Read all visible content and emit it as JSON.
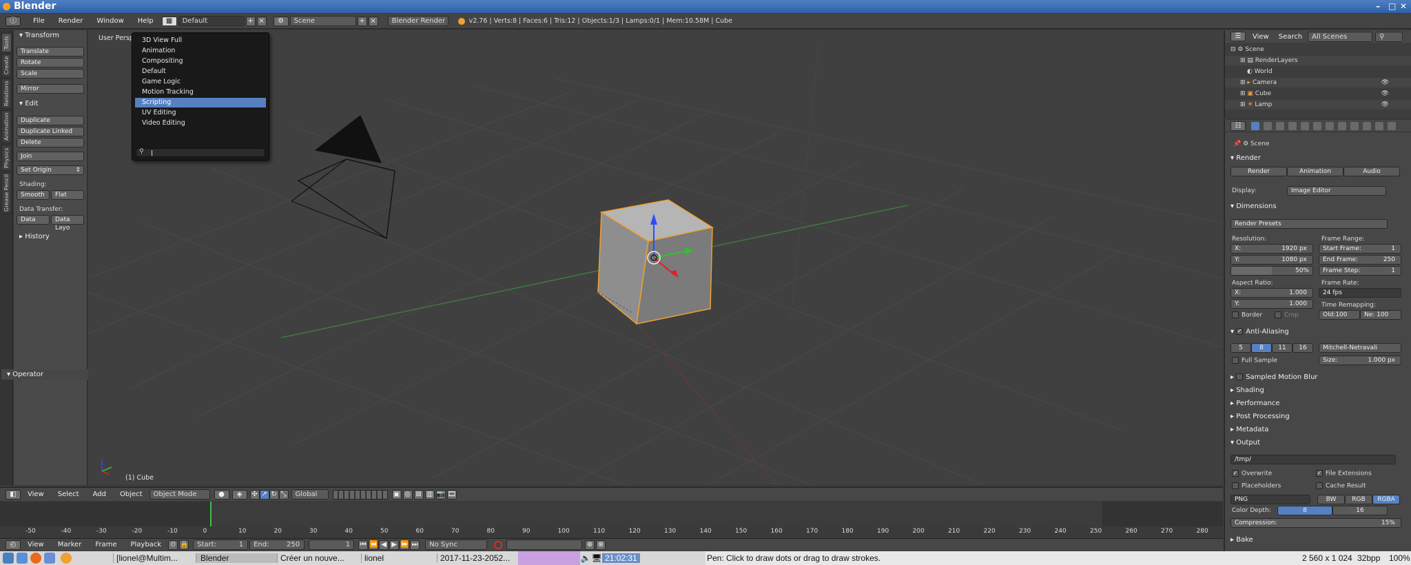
{
  "window": {
    "title": "Blender"
  },
  "menubar": {
    "items": [
      "File",
      "Render",
      "Window",
      "Help"
    ],
    "layout": "Default",
    "scene": "Scene",
    "engine": "Blender Render",
    "stats": "v2.76 | Verts:8 | Faces:6 | Tris:12 | Objects:1/3 | Lamps:0/1 | Mem:10.58M | Cube"
  },
  "tabs": [
    "Tools",
    "Create",
    "Relations",
    "Animation",
    "Physics",
    "Grease Pencil"
  ],
  "tools": {
    "transform_header": "Transform",
    "translate": "Translate",
    "rotate": "Rotate",
    "scale": "Scale",
    "mirror": "Mirror",
    "edit_header": "Edit",
    "duplicate": "Duplicate",
    "duplicate_linked": "Duplicate Linked",
    "delete": "Delete",
    "join": "Join",
    "set_origin": "Set Origin",
    "shading_label": "Shading:",
    "smooth": "Smooth",
    "flat": "Flat",
    "data_transfer_label": "Data Transfer:",
    "data": "Data",
    "data_layo": "Data Layo",
    "history_header": "History",
    "operator_header": "Operator"
  },
  "viewport": {
    "persp": "User Persp",
    "object_label": "(1) Cube"
  },
  "dropdown": {
    "items": [
      "3D View Full",
      "Animation",
      "Compositing",
      "Default",
      "Game Logic",
      "Motion Tracking",
      "Scripting",
      "UV Editing",
      "Video Editing"
    ],
    "selected": "Scripting"
  },
  "vp_header": {
    "view": "View",
    "select": "Select",
    "add": "Add",
    "object": "Object",
    "mode": "Object Mode",
    "orientation": "Global"
  },
  "timeline": {
    "ticks": [
      "-50",
      "-40",
      "-30",
      "-20",
      "-10",
      "0",
      "10",
      "20",
      "30",
      "40",
      "50",
      "60",
      "70",
      "80",
      "90",
      "100",
      "110",
      "120",
      "130",
      "140",
      "150",
      "160",
      "170",
      "180",
      "190",
      "200",
      "210",
      "220",
      "230",
      "240",
      "250",
      "260",
      "270",
      "280"
    ],
    "view": "View",
    "marker": "Marker",
    "frame": "Frame",
    "playback": "Playback",
    "start": "Start:",
    "start_val": "1",
    "end": "End:",
    "end_val": "250",
    "current": "1",
    "sync": "No Sync"
  },
  "outliner": {
    "view": "View",
    "search": "Search",
    "filter": "All Scenes",
    "items": [
      "Scene",
      "RenderLayers",
      "World",
      "Camera",
      "Cube",
      "Lamp"
    ]
  },
  "props": {
    "scene": "Scene",
    "render_header": "Render",
    "render_btn": "Render",
    "animation_btn": "Animation",
    "audio_btn": "Audio",
    "display_label": "Display:",
    "display_val": "Image Editor",
    "dimensions_header": "Dimensions",
    "render_presets": "Render Presets",
    "resolution_label": "Resolution:",
    "res_x_label": "X:",
    "res_x": "1920 px",
    "res_y_label": "Y:",
    "res_y": "1080 px",
    "res_pct": "50%",
    "frame_range_label": "Frame Range:",
    "start_frame_label": "Start Frame:",
    "start_frame": "1",
    "end_frame_label": "End Frame:",
    "end_frame": "250",
    "frame_step_label": "Frame Step:",
    "frame_step": "1",
    "aspect_label": "Aspect Ratio:",
    "asp_x_label": "X:",
    "asp_x": "1.000",
    "asp_y_label": "Y:",
    "asp_y": "1.000",
    "frame_rate_label": "Frame Rate:",
    "frame_rate": "24 fps",
    "time_remap_label": "Time Remapping:",
    "old": "Old:100",
    "new": "Ne: 100",
    "border": "Border",
    "crop": "Crop",
    "aa_header": "Anti-Aliasing",
    "aa_samples": [
      "5",
      "8",
      "11",
      "16"
    ],
    "aa_filter": "Mitchell-Netravali",
    "full_sample": "Full Sample",
    "size": "Size:",
    "size_val": "1.000 px",
    "smb": "Sampled Motion Blur",
    "shading": "Shading",
    "performance": "Performance",
    "post_processing": "Post Processing",
    "metadata": "Metadata",
    "output_header": "Output",
    "output_path": "/tmp/",
    "overwrite": "Overwrite",
    "file_extensions": "File Extensions",
    "placeholders": "Placeholders",
    "cache_result": "Cache Result",
    "format": "PNG",
    "bw": "BW",
    "rgb": "RGB",
    "rgba": "RGBA",
    "color_depth": "Color Depth:",
    "cd8": "8",
    "cd16": "16",
    "compression": "Compression:",
    "compression_val": "15%",
    "bake": "Bake"
  },
  "taskbar": {
    "items": [
      "[lionel@Multim...",
      "Blender",
      "Créer un nouve...",
      "lionel",
      "2017-11-23-2052..."
    ],
    "clock": "21:02:31"
  },
  "status": {
    "message": "Pen: Click to draw dots or drag to draw strokes.",
    "resolution": "2 560 x 1 024",
    "bpp": "32bpp",
    "zoom": "100%"
  },
  "colors": {
    "selection": "#5680c2",
    "accent_orange": "#f0a030"
  }
}
